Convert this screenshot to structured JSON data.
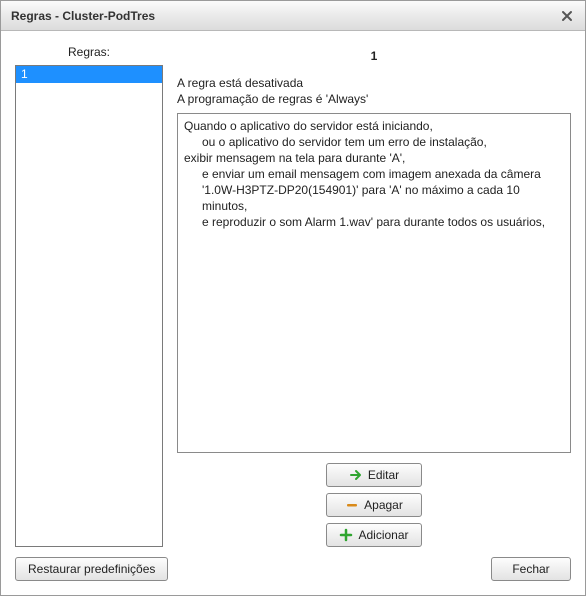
{
  "window": {
    "title": "Regras - Cluster-PodTres"
  },
  "sidebar": {
    "label": "Regras:",
    "items": [
      {
        "name": "1",
        "selected": true
      }
    ]
  },
  "detail": {
    "heading": "1",
    "status_line1": "A regra está desativada",
    "status_line2": "A programação de regras é 'Always'",
    "body": {
      "l0": "Quando o aplicativo do servidor está iniciando,",
      "l1": "ou o aplicativo do servidor tem um erro de instalação,",
      "l2": "exibir mensagem na tela para durante 'A',",
      "l3": "e enviar um email mensagem com imagem anexada da câmera '1.0W-H3PTZ-DP20(154901)' para 'A' no máximo a cada 10 minutos,",
      "l4": "e reproduzir o som Alarm 1.wav' para durante todos os usuários,"
    }
  },
  "buttons": {
    "edit": "Editar",
    "delete": "Apagar",
    "add": "Adicionar",
    "restore": "Restaurar predefinições",
    "close": "Fechar"
  },
  "icons": {
    "edit": "arrow-right-icon",
    "delete": "minus-icon",
    "add": "plus-icon"
  }
}
